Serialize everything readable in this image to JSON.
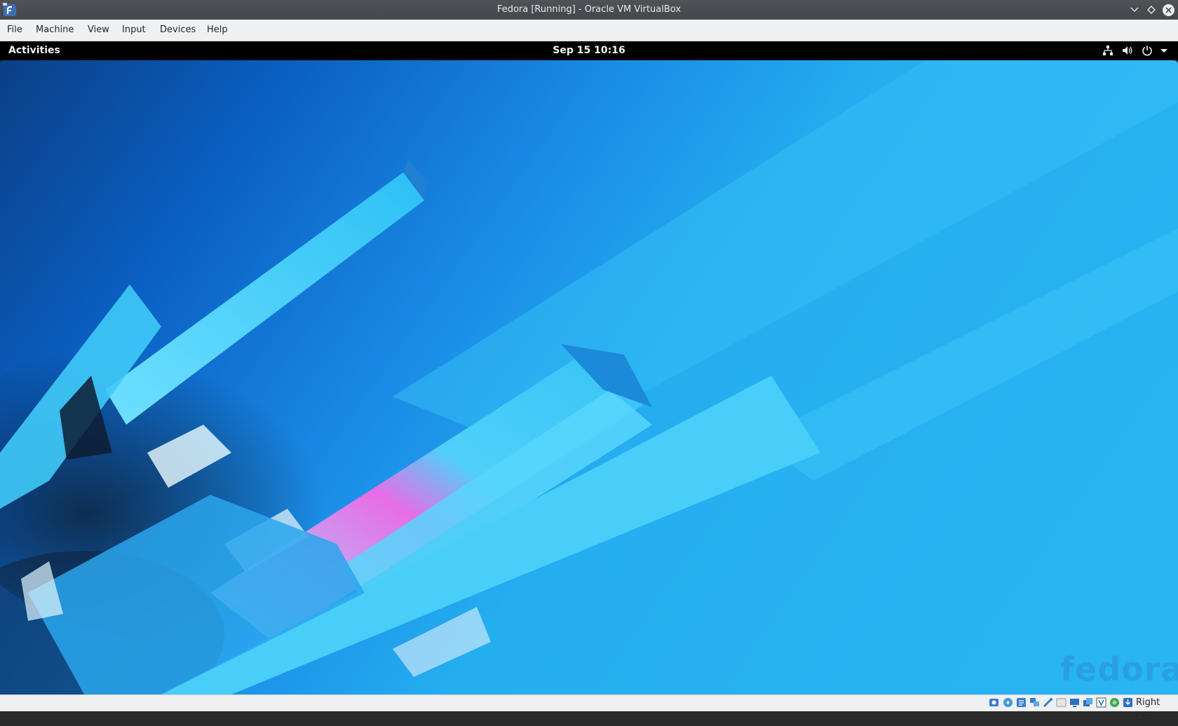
{
  "window": {
    "title": "Fedora [Running] - Oracle VM VirtualBox",
    "controls": [
      "minimize",
      "maximize",
      "close"
    ]
  },
  "menubar": {
    "items": [
      "File",
      "Machine",
      "View",
      "Input",
      "Devices",
      "Help"
    ]
  },
  "guest_topbar": {
    "activities": "Activities",
    "clock": "Sep 15  10:16",
    "tray_icons": [
      "network-icon",
      "volume-icon",
      "power-icon",
      "dropdown-arrow-icon"
    ]
  },
  "desktop": {
    "wallpaper_watermark": "fedora"
  },
  "statusbar": {
    "icons": [
      "hard-disk-icon",
      "optical-drive-icon",
      "audio-icon",
      "network-icon",
      "usb-icon",
      "shared-folders-icon",
      "display-icon",
      "video-capture-icon",
      "recording-icon",
      "virtualization-icon",
      "mouse-integration-icon",
      "keyboard-icon"
    ],
    "host_key": "Right Ctrl"
  },
  "colors": {
    "titlebar": "#474b50",
    "menubar": "#eff0f1",
    "topbar": "#000000",
    "wallpaper_light": "#29b5f3",
    "wallpaper_dark": "#0b3f86",
    "accent_pink": "#e86de6"
  }
}
